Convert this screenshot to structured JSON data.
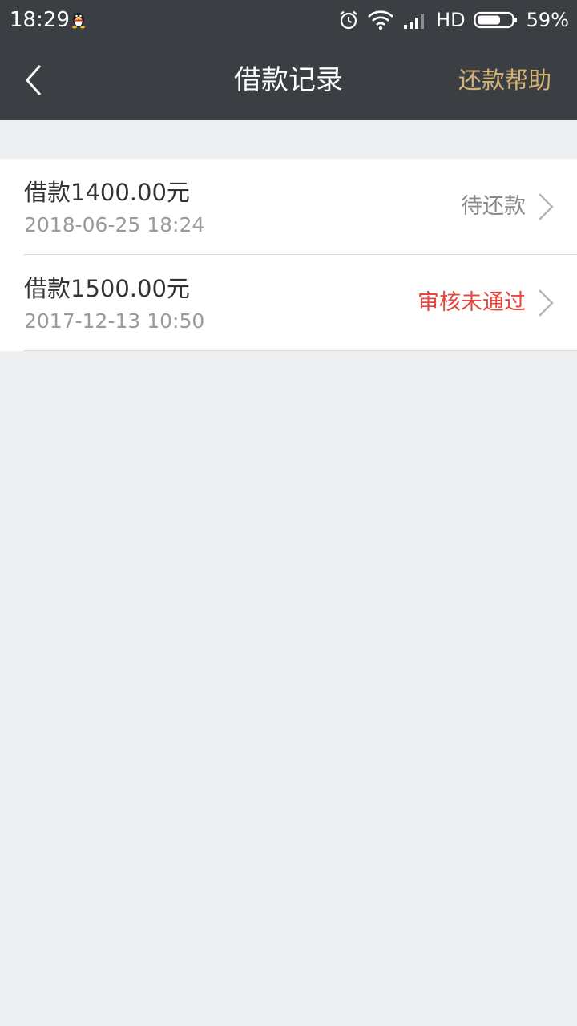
{
  "status_bar": {
    "time": "18:29",
    "network": "HD",
    "battery": "59%",
    "icons": [
      "qq-icon",
      "alarm-icon",
      "wifi-icon",
      "signal-icon",
      "battery-icon"
    ]
  },
  "nav": {
    "back_icon": "chevron-left-icon",
    "title": "借款记录",
    "help": "还款帮助"
  },
  "records": [
    {
      "amount": "借款1400.00元",
      "date": "2018-06-25 18:24",
      "status": "待还款",
      "status_color": "#8a8a8a"
    },
    {
      "amount": "借款1500.00元",
      "date": "2017-12-13 10:50",
      "status": "审核未通过",
      "status_color": "#e8473f"
    }
  ],
  "colors": {
    "header_bg": "#3b3f44",
    "accent_gold": "#d4b373",
    "page_bg": "#eeeff1"
  }
}
